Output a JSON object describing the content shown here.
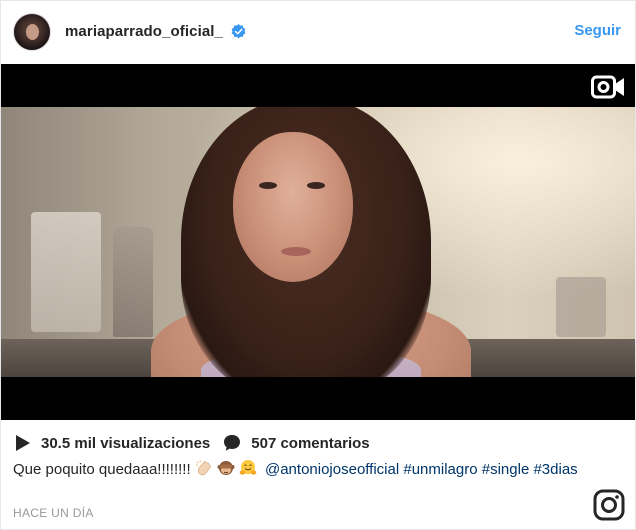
{
  "header": {
    "username": "mariaparrado_oficial_",
    "verified_icon": "verified-badge-icon",
    "follow_label": "Seguir"
  },
  "video": {
    "camera_icon": "video-camera-icon"
  },
  "stats": {
    "views": "30.5 mil visualizaciones",
    "comments": "507 comentarios",
    "play_icon": "play-icon",
    "comment_icon": "comment-bubble-icon"
  },
  "caption": {
    "text": "Que poquito quedaaa!!!!!!!!",
    "emojis": [
      "clapping-hands-emoji",
      "see-no-evil-monkey-emoji",
      "hugging-face-emoji"
    ],
    "mention": "@antoniojoseofficial",
    "hashtags": [
      "#unmilagro",
      "#single",
      "#3dias"
    ]
  },
  "timestamp": "HACE UN DÍA",
  "footer": {
    "logo_icon": "instagram-logo-icon"
  },
  "colors": {
    "link_blue": "#3897f0",
    "mention_blue": "#003569",
    "text": "#262626",
    "muted": "#999999",
    "verified": "#3897f0"
  }
}
